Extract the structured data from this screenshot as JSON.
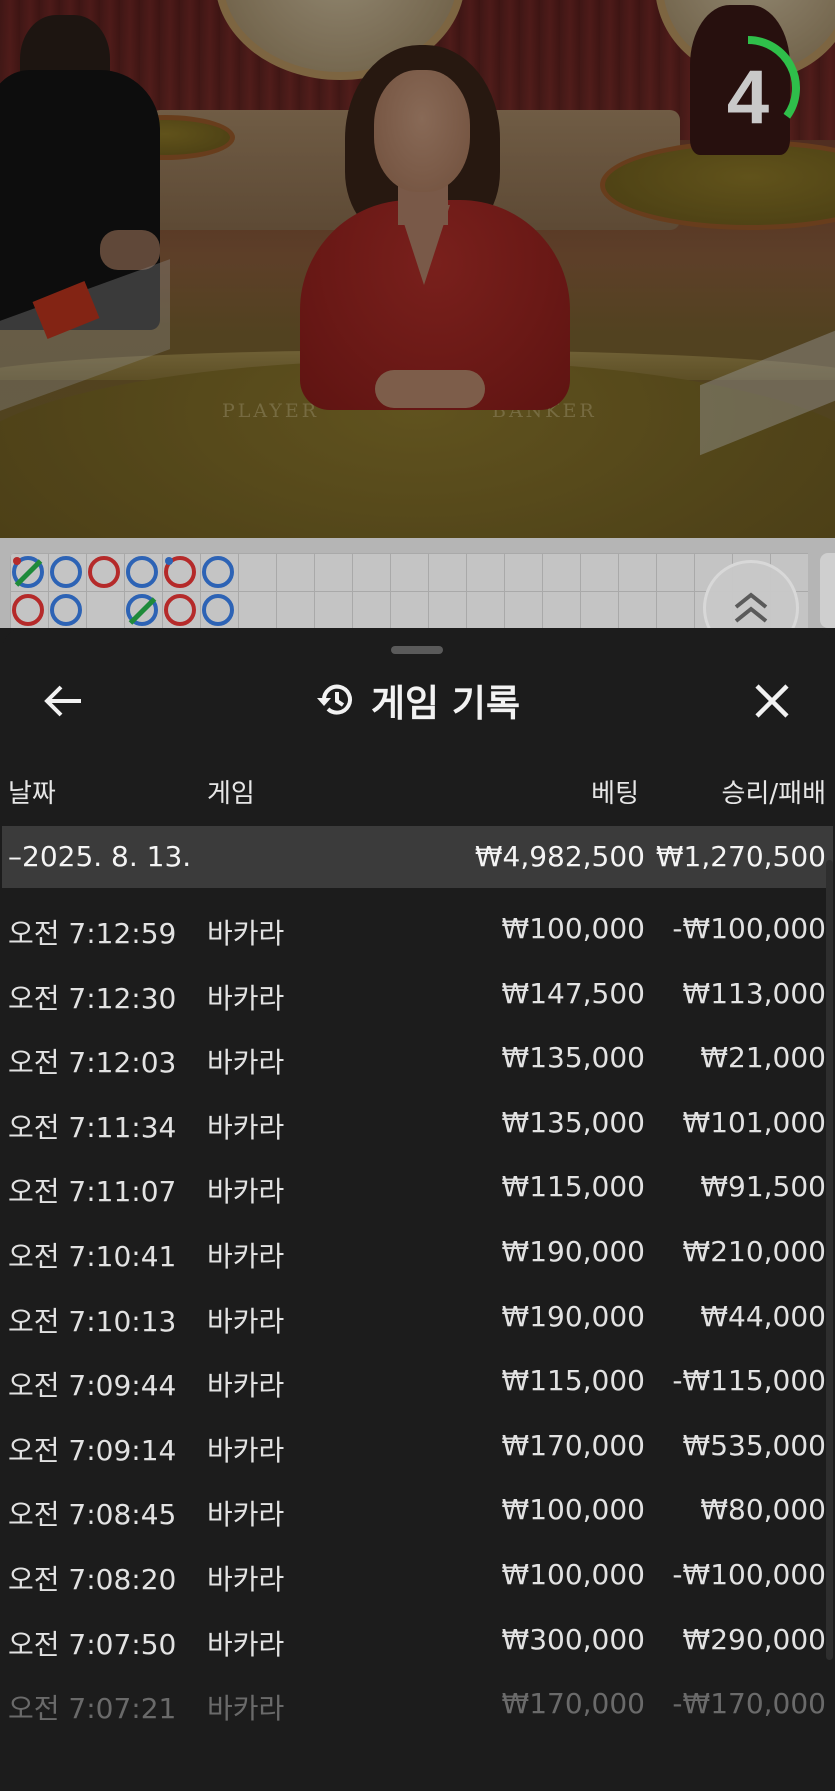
{
  "video": {
    "countdown": "4",
    "countdown_fraction": 0.35,
    "countdown_color": "#2fbf4a",
    "felt_labels": {
      "player": "PLAYER",
      "banker": "BANKER"
    }
  },
  "roadmap": {
    "beads": [
      {
        "col": 0,
        "row": 0,
        "color": "blue",
        "tie": true,
        "pair_dot": "red"
      },
      {
        "col": 1,
        "row": 0,
        "color": "blue"
      },
      {
        "col": 2,
        "row": 0,
        "color": "red"
      },
      {
        "col": 3,
        "row": 0,
        "color": "blue"
      },
      {
        "col": 4,
        "row": 0,
        "color": "red",
        "pair_dot": "blue"
      },
      {
        "col": 5,
        "row": 0,
        "color": "blue"
      },
      {
        "col": 0,
        "row": 1,
        "color": "red"
      },
      {
        "col": 1,
        "row": 1,
        "color": "blue"
      },
      {
        "col": 3,
        "row": 1,
        "color": "blue",
        "tie": true
      },
      {
        "col": 4,
        "row": 1,
        "color": "red"
      },
      {
        "col": 5,
        "row": 1,
        "color": "blue"
      }
    ],
    "expand_icon": "double-chevron-up-icon"
  },
  "history": {
    "title": "게임 기록",
    "title_icon": "history-icon",
    "back_icon": "arrow-left-icon",
    "close_icon": "close-icon",
    "columns": {
      "date": "날짜",
      "game": "게임",
      "bet": "베팅",
      "result": "승리/패배"
    },
    "summary": {
      "date": "–2025. 8. 13.",
      "bet": "₩4,982,500",
      "result": "₩1,270,500"
    },
    "rows": [
      {
        "time": "오전 7:12:59",
        "game": "바카라",
        "bet": "₩100,000",
        "result": "-₩100,000"
      },
      {
        "time": "오전 7:12:30",
        "game": "바카라",
        "bet": "₩147,500",
        "result": "₩113,000"
      },
      {
        "time": "오전 7:12:03",
        "game": "바카라",
        "bet": "₩135,000",
        "result": "₩21,000"
      },
      {
        "time": "오전 7:11:34",
        "game": "바카라",
        "bet": "₩135,000",
        "result": "₩101,000"
      },
      {
        "time": "오전 7:11:07",
        "game": "바카라",
        "bet": "₩115,000",
        "result": "₩91,500"
      },
      {
        "time": "오전 7:10:41",
        "game": "바카라",
        "bet": "₩190,000",
        "result": "₩210,000"
      },
      {
        "time": "오전 7:10:13",
        "game": "바카라",
        "bet": "₩190,000",
        "result": "₩44,000"
      },
      {
        "time": "오전 7:09:44",
        "game": "바카라",
        "bet": "₩115,000",
        "result": "-₩115,000"
      },
      {
        "time": "오전 7:09:14",
        "game": "바카라",
        "bet": "₩170,000",
        "result": "₩535,000"
      },
      {
        "time": "오전 7:08:45",
        "game": "바카라",
        "bet": "₩100,000",
        "result": "₩80,000"
      },
      {
        "time": "오전 7:08:20",
        "game": "바카라",
        "bet": "₩100,000",
        "result": "-₩100,000"
      },
      {
        "time": "오전 7:07:50",
        "game": "바카라",
        "bet": "₩300,000",
        "result": "₩290,000"
      },
      {
        "time": "오전 7:07:21",
        "game": "바카라",
        "bet": "₩170,000",
        "result": "-₩170,000"
      }
    ]
  }
}
